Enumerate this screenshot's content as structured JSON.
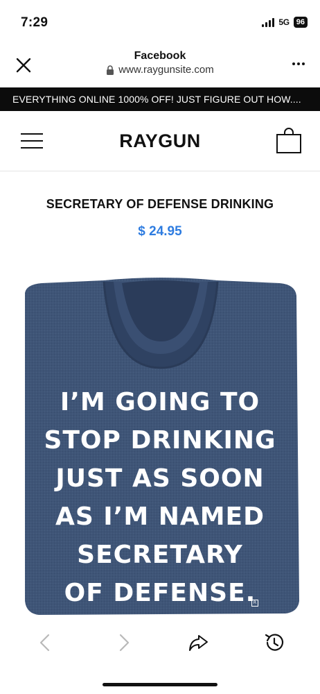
{
  "status_bar": {
    "time": "7:29",
    "network": "5G",
    "battery": "96"
  },
  "browser": {
    "title": "Facebook",
    "url": "www.raygunsite.com"
  },
  "promo_banner": {
    "text": "EVERYTHING ONLINE 1000% OFF! JUST FIGURE OUT HOW...."
  },
  "site": {
    "logo": "RAYGUN"
  },
  "product": {
    "title": "SECRETARY OF DEFENSE DRINKING",
    "price": "$ 24.95",
    "price_color": "#2e7ce0",
    "shirt_color": "#3f5577",
    "shirt_lines": [
      "I’M GOING TO",
      "STOP DRINKING",
      "JUST AS SOON",
      "AS I’M NAMED",
      "SECRETARY",
      "OF DEFENSE."
    ]
  },
  "toolbar": {
    "back_disabled": true,
    "forward_disabled": true
  }
}
